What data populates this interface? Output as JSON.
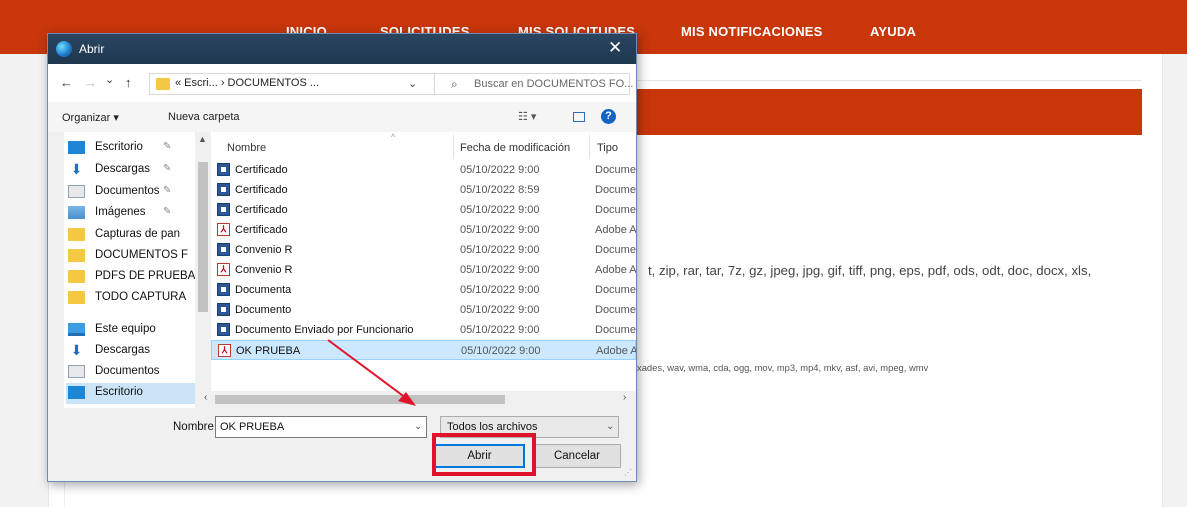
{
  "site_nav": {
    "items": [
      "INICIO",
      "SOLICITUDES",
      "MIS SOLICITUDES",
      "MIS NOTIFICACIONES",
      "AYUDA"
    ]
  },
  "page": {
    "extensions_line1": "t, zip, rar, tar, 7z, gz, jpeg, jpg, gif, tiff, png, eps, pdf, ods, odt, doc, docx, xls,",
    "extensions_line2": "xades, wav, wma, cda, ogg, mov, mp3, mp4, mkv, asf, avi, mpeg, wmv"
  },
  "dialog": {
    "title": "Abrir",
    "back_glyph": "←",
    "forward_glyph": "→",
    "recent_glyph": "⌄",
    "up_glyph": "↑",
    "address": "« Escri...  ›  DOCUMENTOS ...",
    "search_placeholder": "Buscar en DOCUMENTOS FO...",
    "toolbar": {
      "organize": "Organizar ▾",
      "new_folder": "Nueva carpeta",
      "view": "☷ ▾",
      "help": "?"
    },
    "nav_items": [
      {
        "label": "Escritorio",
        "icon": "desktop-icon",
        "pinned": true
      },
      {
        "label": "Descargas",
        "icon": "download-icon",
        "pinned": true
      },
      {
        "label": "Documentos",
        "icon": "document-icon",
        "pinned": true
      },
      {
        "label": "Imágenes",
        "icon": "pictures-icon",
        "pinned": true
      },
      {
        "label": "Capturas de pan",
        "icon": "folder-icon",
        "pinned": false
      },
      {
        "label": "DOCUMENTOS F",
        "icon": "folder-icon",
        "pinned": false
      },
      {
        "label": "PDFS DE PRUEBA",
        "icon": "folder-icon",
        "pinned": false
      },
      {
        "label": "TODO CAPTURA",
        "icon": "folder-icon",
        "pinned": false
      },
      {
        "label": "Este equipo",
        "icon": "computer-icon",
        "pinned": false
      },
      {
        "label": "Descargas",
        "icon": "download-icon",
        "pinned": false
      },
      {
        "label": "Documentos",
        "icon": "document-icon",
        "pinned": false
      },
      {
        "label": "Escritorio",
        "icon": "desktop-icon",
        "pinned": false
      }
    ],
    "columns": {
      "name": "Nombre",
      "date": "Fecha de modificación",
      "type": "Tipo"
    },
    "files": [
      {
        "name": "Certificado",
        "date": "05/10/2022 9:00",
        "type": "Docume",
        "kind": "word"
      },
      {
        "name": "Certificado",
        "date": "05/10/2022 8:59",
        "type": "Docume",
        "kind": "word"
      },
      {
        "name": "Certificado",
        "date": "05/10/2022 9:00",
        "type": "Docume",
        "kind": "word"
      },
      {
        "name": "Certificado",
        "date": "05/10/2022 9:00",
        "type": "Adobe A",
        "kind": "pdf"
      },
      {
        "name": "Convenio R",
        "date": "05/10/2022 9:00",
        "type": "Docume",
        "kind": "word"
      },
      {
        "name": "Convenio R",
        "date": "05/10/2022 9:00",
        "type": "Adobe A",
        "kind": "pdf"
      },
      {
        "name": "Documenta",
        "date": "05/10/2022 9:00",
        "type": "Docume",
        "kind": "word"
      },
      {
        "name": "Documento",
        "date": "05/10/2022 9:00",
        "type": "Docume",
        "kind": "word"
      },
      {
        "name": "Documento Enviado por Funcionario",
        "date": "05/10/2022 9:00",
        "type": "Docume",
        "kind": "word"
      },
      {
        "name": "OK PRUEBA",
        "date": "05/10/2022 9:00",
        "type": "Adobe A",
        "kind": "pdf",
        "selected": true
      }
    ],
    "name_label": "Nombre:",
    "name_value": "OK PRUEBA",
    "filter_value": "Todos los archivos",
    "open_button": "Abrir",
    "cancel_button": "Cancelar"
  },
  "colors": {
    "brand": "#c8360a",
    "annotation": "#e0132b"
  }
}
